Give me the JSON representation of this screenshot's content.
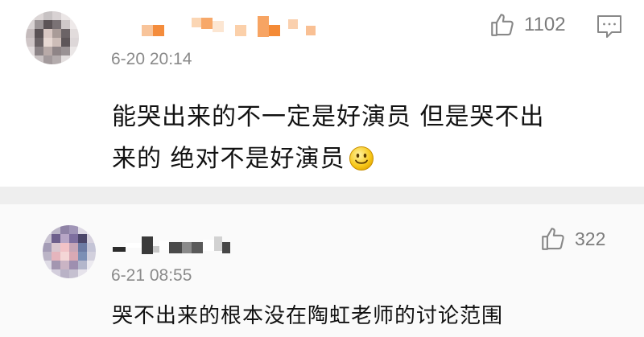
{
  "comments": [
    {
      "timestamp": "6-20 20:14",
      "like_count": "1102",
      "text_line1": "能哭出来的不一定是好演员 但是哭不出",
      "text_line2": "来的 绝对不是好演员",
      "has_reply_icon": true,
      "emoji": "smiling-face"
    },
    {
      "timestamp": "6-21 08:55",
      "like_count": "322",
      "text_line1": "哭不出来的根本没在陶虹老师的讨论范围",
      "has_reply_icon": false
    }
  ],
  "colors": {
    "like_icon": "#888888",
    "timestamp": "#8a8a8a",
    "separator": "#eeeeee",
    "username_mosaic_orange": "#f5a05a"
  },
  "icons": {
    "like": "thumbs-up-icon",
    "reply": "comment-bubble-icon",
    "emoji": "smiling-face-emoji"
  }
}
